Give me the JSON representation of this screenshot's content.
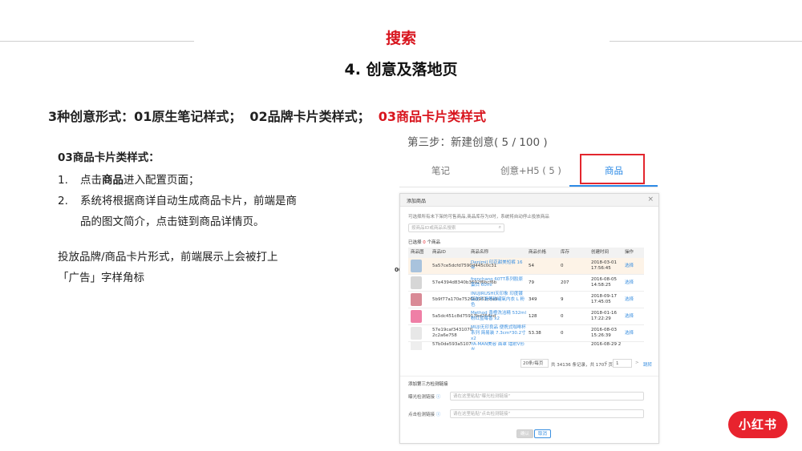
{
  "slide": {
    "section_title": "搜索",
    "page_title": "4. 创意及落地页",
    "formats": {
      "f1": "3种创意形式：01原生笔记样式；",
      "f2": "02品牌卡片类样式；",
      "f3": "03商品卡片类样式",
      "highlight_color": "#d8141d"
    },
    "left": {
      "heading": "03商品卡片类样式：",
      "step1": {
        "num": "1.",
        "pre": "点击",
        "bold": "商品",
        "post": "进入配置页面；"
      },
      "step2": {
        "num": "2.",
        "text": "系统将根据商详自动生成商品卡片，前端是商品的图文简介，点击链到商品详情页。"
      },
      "note": "投放品牌/商品卡片形式，前端展示上会被打上「广告」字样角标"
    },
    "logo_text": "小红书"
  },
  "screenshot": {
    "step_label": "第三步：新建创意( 5 / 100 )",
    "tabs": [
      "笔记",
      "创意+H5 ( 5 )",
      "商品"
    ],
    "active_tab": "商品",
    "accent_color": "#2e8be6",
    "side_clip_text": "00",
    "dialog": {
      "title": "添加商品",
      "close_icon": "×",
      "tip": "可选择所有未下架的可售商品,商品库存为0时，系统将自动停止投放商品",
      "search_placeholder": "按商品ID或商品名搜索",
      "selected_label": "已选择",
      "selected_count": "0",
      "selected_unit": "个商品",
      "columns": [
        "商品图",
        "商品ID",
        "商品名称",
        "商品价格",
        "库存",
        "创建时间",
        "操作"
      ],
      "rows": [
        {
          "id": "5a57ce5dcfd7590d445c0c31",
          "name": "Denimil 印花甜美短裤 16年",
          "price": "54",
          "stock": "0",
          "time": "2018-03-01 17:56:45",
          "op": "选择",
          "thumb_color": "#a9c3dd",
          "selected": true
        },
        {
          "id": "57e4394d8340b3692f6bcf6b",
          "name": "frenchano 60TT系列胶原蛋白 60ml",
          "price": "79",
          "stock": "207",
          "time": "2016-08-05 14:58:25",
          "op": "选择",
          "thumb_color": "#d6d6d6",
          "selected": false
        },
        {
          "id": "5b9f77a170e7526b3961cda9",
          "name": "INUJIRUSHI天印象 印度镀铝防下滑等粉罐氧内衣 L 粉色",
          "price": "349",
          "stock": "9",
          "time": "2018-09-17 17:45:05",
          "op": "选择",
          "thumb_color": "#d98a96",
          "selected": false
        },
        {
          "id": "5a5dc451c8d75917bd264ed",
          "name": "Method 香橙洗洁精 532ml 粉红蓝莓香 x2",
          "price": "128",
          "stock": "0",
          "time": "2018-01-16 17:22:29",
          "op": "选择",
          "thumb_color": "#ef7fa6",
          "selected": false
        },
        {
          "id": "57e19caf3431070 2c2a6e758",
          "name": "MUJI无印良品 便携式咖啡杯系列 简易装 7.3cm*30.2寸 x2",
          "price": "53.38",
          "stock": "0",
          "time": "2016-08-03 15:26:39",
          "op": "选择",
          "thumb_color": "#e7e7e7",
          "selected": false
        },
        {
          "id": "57b0de593a5107",
          "name": "YA-MAN美容 面罩 镭射V形光",
          "price": "",
          "stock": "",
          "time": "2016-08-29 2",
          "op": "",
          "thumb_color": "#eeeeee",
          "selected": false
        }
      ],
      "pager": {
        "size": "20条/每页",
        "total": "共 34136 条记录，共 1707 页",
        "prev": "<",
        "page": "1",
        "next": ">",
        "jump": "跳转"
      },
      "third_party": {
        "title": "添加第三方检测链接",
        "f1_label": "曝光检测链接",
        "f1_placeholder": "请在这里粘贴\"曝光检测链接\"",
        "f2_label": "点击检测链接",
        "f2_placeholder": "请在这里粘贴\"点击检测链接\"",
        "info_icon": "ⓘ"
      },
      "buttons": {
        "confirm": "确认",
        "cancel": "取消"
      }
    }
  }
}
